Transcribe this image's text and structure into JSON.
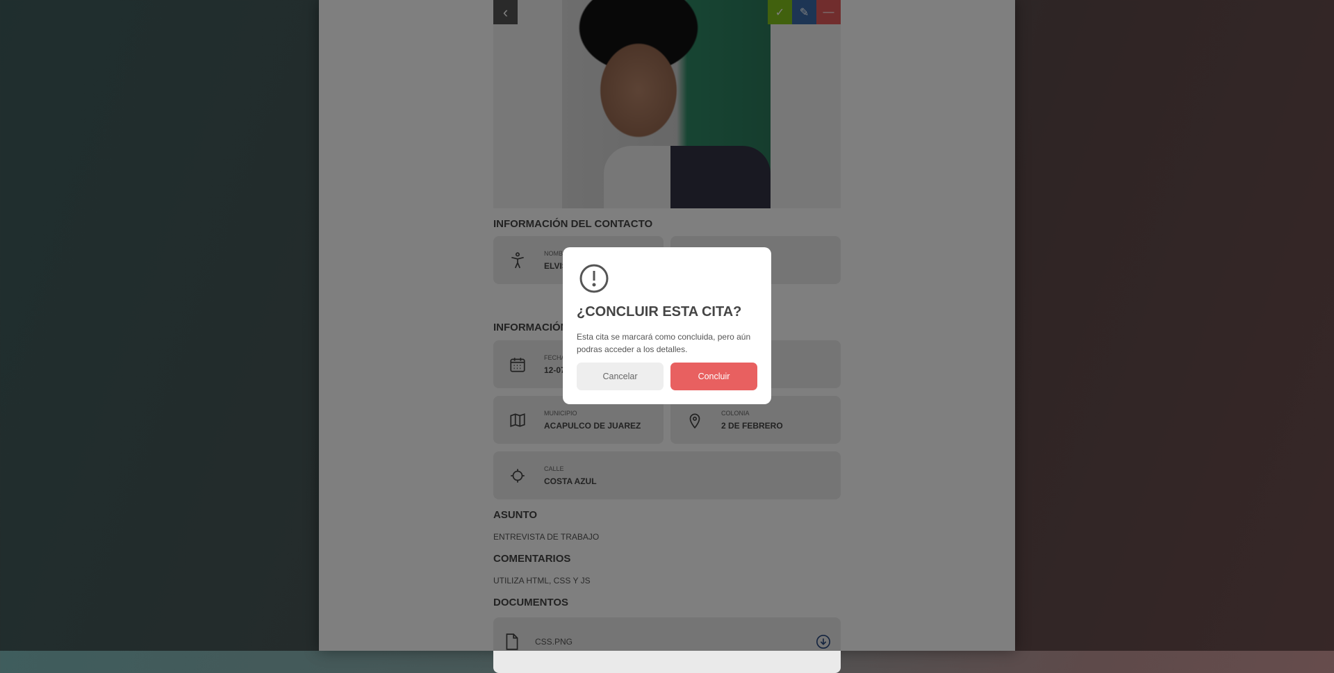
{
  "toolbar": {
    "back_icon": "chevron-left-icon",
    "actions": [
      {
        "icon": "check-icon",
        "color": "#83c21c"
      },
      {
        "icon": "edit-icon",
        "color": "#3a6aa8"
      },
      {
        "icon": "minus-icon",
        "color": "#e25a5a"
      }
    ]
  },
  "contact": {
    "heading": "INFORMACIÓN DEL CONTACTO",
    "name_label": "NOMBRE",
    "name_value": "ELVIS"
  },
  "appointment": {
    "heading": "INFORMACIÓN",
    "date_label": "FECHA",
    "date_value": "12-07",
    "municipio_label": "MUNICIPIO",
    "municipio_value": "ACAPULCO DE JUAREZ",
    "colonia_label": "COLONIA",
    "colonia_value": "2 DE FEBRERO",
    "calle_label": "CALLE",
    "calle_value": "COSTA AZUL"
  },
  "asunto": {
    "heading": "ASUNTO",
    "text": "ENTREVISTA DE TRABAJO"
  },
  "comentarios": {
    "heading": "COMENTARIOS",
    "text": "UTILIZA HTML, CSS Y JS"
  },
  "documentos": {
    "heading": "DOCUMENTOS",
    "items": [
      {
        "name": "CSS.PNG"
      }
    ]
  },
  "modal": {
    "icon": "exclamation-circle-icon",
    "title": "¿CONCLUIR ESTA CITA?",
    "message": "Esta cita se marcará como concluida, pero aún podras acceder a los detalles.",
    "cancel": "Cancelar",
    "confirm": "Concluir",
    "confirm_color": "#e86060"
  }
}
